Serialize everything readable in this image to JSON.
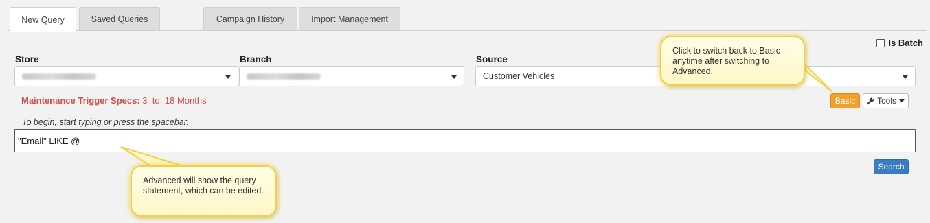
{
  "tabs": [
    {
      "label": "New Query",
      "active": true
    },
    {
      "label": "Saved Queries",
      "active": false
    },
    {
      "label": "Campaign History",
      "active": false
    },
    {
      "label": "Import Management",
      "active": false
    }
  ],
  "filters": {
    "store_label": "Store",
    "branch_label": "Branch",
    "source_label": "Source",
    "source_value": "Customer Vehicles"
  },
  "batch": {
    "label": "Is Batch",
    "checked": false
  },
  "maintenance": {
    "label": "Maintenance Trigger Specs:",
    "from": "3",
    "to_word": "to",
    "to": "18",
    "unit": "Months"
  },
  "toolbar": {
    "basic_label": "Basic",
    "tools_label": "Tools"
  },
  "query": {
    "hint": "To begin, start typing or press the spacebar.",
    "value": "\"Email\" LIKE @"
  },
  "search_label": "Search",
  "callouts": {
    "basic_tip": "Click to switch back to Basic anytime after switching to Advanced.",
    "advanced_tip": "Advanced will show the query statement, which can be edited."
  },
  "colors": {
    "basic_button": "#f0a12c",
    "search_button": "#3a7cc3",
    "maintenance_text": "#c9524f",
    "callout_border": "#f2d14a"
  },
  "icons": {
    "tools": "wrench-icon",
    "dropdown": "chevron-down-icon"
  }
}
